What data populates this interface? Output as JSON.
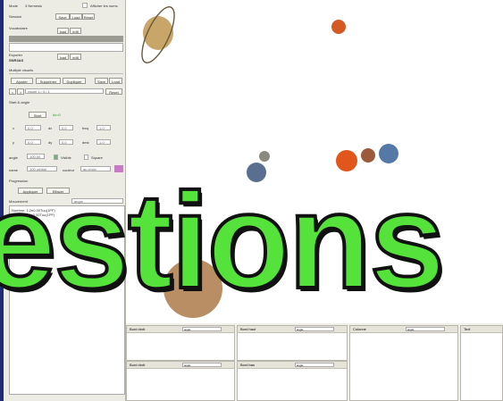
{
  "left_panel": {
    "mode_label": "Mode",
    "mode_value": "3 Nemesis",
    "checkbox_label": "Afficher les noms",
    "session_label": "Session",
    "session_buttons": [
      "Save",
      "Load",
      "Reset"
    ],
    "vocabulary_label": "Vocabulaire",
    "mini_buttons": [
      "load",
      "edit"
    ],
    "exporter_label": "Exporter",
    "exporter_value": "SNR3AS",
    "multiple_label": "Multiple visuels",
    "action_buttons": [
      "Ajouter",
      "Supprimer",
      "Dupliquer",
      "Save",
      "Load"
    ],
    "selected_visual": "visuel 1 / 3 / 1",
    "reset_button": "Reset",
    "start_label": "Start & angle",
    "start_button": "Start",
    "start_status": "dx=0",
    "fields": [
      {
        "label": "x",
        "value": "0.0"
      },
      {
        "label": "dx",
        "value": "0.0"
      },
      {
        "label": "freq",
        "value": "1.0"
      },
      {
        "label": "y",
        "value": "0.0"
      },
      {
        "label": "dy",
        "value": "0.0"
      },
      {
        "label": "dest",
        "value": "1.0"
      }
    ],
    "angle_label": "angle",
    "angle_value": "100.00",
    "visible_label": "Visible",
    "square_label": "Square",
    "name_label": "name",
    "name_value": "100 orbital",
    "color_label": "couleur",
    "color_value": "au choix",
    "color_swatch": "#c77bc6",
    "progression_label": "Progression",
    "progression_buttons": [
      "Appliquer",
      "Effacer"
    ],
    "mouvement_label": "Mouvement",
    "mouvement_select": "angle",
    "log_lines": [
      "Nombre: 1.2e0.00Tuu(1PF)",
      "Ampleur 1.2e0.00Tuu(1PF)",
      "angle: angle=0"
    ]
  },
  "bottom_panels": [
    {
      "title": "Bord droit",
      "select": "angle"
    },
    {
      "title": "Bord haut",
      "select": "angle"
    },
    {
      "title": "Colonne",
      "select": "angle"
    },
    {
      "title": "Text",
      "select": ""
    },
    {
      "title": "Bord droit",
      "select": "angle"
    },
    {
      "title": "Bord bas",
      "select": "angle"
    }
  ],
  "planets": [
    {
      "name": "saturn",
      "color": "#c8a66a"
    },
    {
      "name": "mars-top",
      "color": "#d35a22"
    },
    {
      "name": "mercury",
      "color": "#8a8a80"
    },
    {
      "name": "earth-left",
      "color": "#5a6e8f"
    },
    {
      "name": "mars-right",
      "color": "#e0561b"
    },
    {
      "name": "venus",
      "color": "#9b5a3c"
    },
    {
      "name": "earth-right",
      "color": "#5678a6"
    },
    {
      "name": "jupiter",
      "color": "#b98e64"
    }
  ],
  "overlay_text": "estions"
}
